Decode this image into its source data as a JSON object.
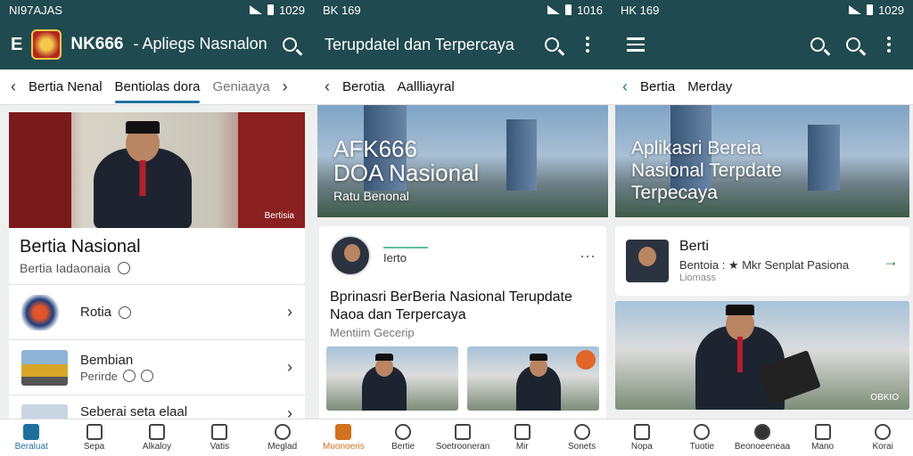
{
  "screen1": {
    "status": {
      "left": "NI97AJAS",
      "right": "1029"
    },
    "appbar": {
      "logo_letter": "E",
      "brand": "NK666",
      "title": "- Apliegs Nasnalonn"
    },
    "tabs": [
      "Bertia Nenal",
      "Bentiolas dora",
      "Geniaaya"
    ],
    "hero_watermark": "Bertisia",
    "headline": {
      "title": "Bertia Nasional",
      "subtitle": "Bertia Iadaonaia"
    },
    "list": [
      {
        "title": "Rotia",
        "meta": ""
      },
      {
        "title": "Bembian",
        "meta": "Perirde"
      },
      {
        "title": "Seberai seta elaal",
        "meta": ""
      }
    ],
    "nav": [
      "Beraluat",
      "Sepa",
      "Alkaloy",
      "Vatis",
      "Meglad"
    ]
  },
  "screen2": {
    "status": {
      "left": "BK 169",
      "right": "1016"
    },
    "appbar": {
      "title": "Terupdatel dan Terpercaya"
    },
    "tabs": [
      "Berotia",
      "Aallliayral"
    ],
    "hero": {
      "line1": "AFK666",
      "line2": "DOA Nasional",
      "line3": "Ratu Benonal"
    },
    "post": {
      "author": "Ierto",
      "title": "Bprinasri BerBeria Nasional Terupdate Naoa dan Terpercaya",
      "subtitle": "Mentiim Gecerip"
    },
    "nav": [
      "Muonoeris",
      "Bertie",
      "Soetrooneran",
      "Mir",
      "Sonets"
    ]
  },
  "screen3": {
    "status": {
      "left": "HK 169",
      "right": "1029"
    },
    "tabs": [
      "Bertia",
      "Merday"
    ],
    "hero": {
      "line1": "Aplikasri Bereia",
      "line2": "Nasional Terpdate",
      "line3": "Terpecaya"
    },
    "card": {
      "title": "Berti",
      "meta": "Bentoia : ★ Mkr Senplat Pasiona",
      "sub": "Liomass"
    },
    "photo_watermark": "OBKIO",
    "nav": [
      "Nopa",
      "Tuotie",
      "Beonoeeneaa",
      "Mano",
      "Korai"
    ]
  },
  "colors": {
    "appbar": "#1f4a50",
    "accent_blue": "#1f6f9c",
    "accent_orange": "#d2711e"
  }
}
